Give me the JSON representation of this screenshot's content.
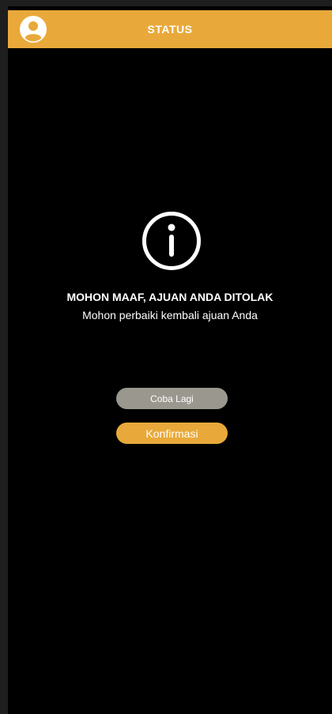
{
  "header": {
    "title": "STATUS",
    "avatar_icon": "user-circle-icon",
    "background": "#e9a93a"
  },
  "content": {
    "icon": "info-circle-icon",
    "title": "MOHON MAAF, AJUAN ANDA DITOLAK",
    "subtitle": "Mohon perbaiki kembali ajuan Anda"
  },
  "buttons": {
    "retry_label": "Coba Lagi",
    "retry_color": "#9a978e",
    "confirm_label": "Konfirmasi",
    "confirm_color": "#e9a93a"
  }
}
